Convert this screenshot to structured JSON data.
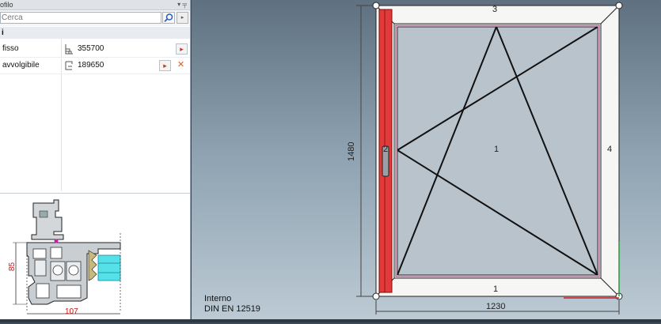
{
  "panel": {
    "title": "ofilo",
    "pin_icons": "▾  ╤",
    "search_placeholder": "Cerca",
    "search_icon": "search-icon",
    "group_label": "i",
    "properties": [
      {
        "name": "fisso",
        "value": "355700",
        "icon": "frame-profile-icon"
      },
      {
        "name": "avvolgibile",
        "value": "189650",
        "icon": "shutter-profile-icon"
      }
    ],
    "preview": {
      "dim_vertical": "85",
      "dim_horizontal": "107"
    }
  },
  "canvas": {
    "note_side": "Interno",
    "note_standard": "DIN EN 12519",
    "label_top": "3",
    "label_bottom": "1",
    "label_left": "2",
    "label_right": "4",
    "label_center": "1",
    "dim_height": "1480",
    "dim_width": "1230"
  },
  "colors": {
    "accent_red": "#e23a3a",
    "frame_white": "#f6f6f4",
    "glass": "#b9c3cb"
  }
}
